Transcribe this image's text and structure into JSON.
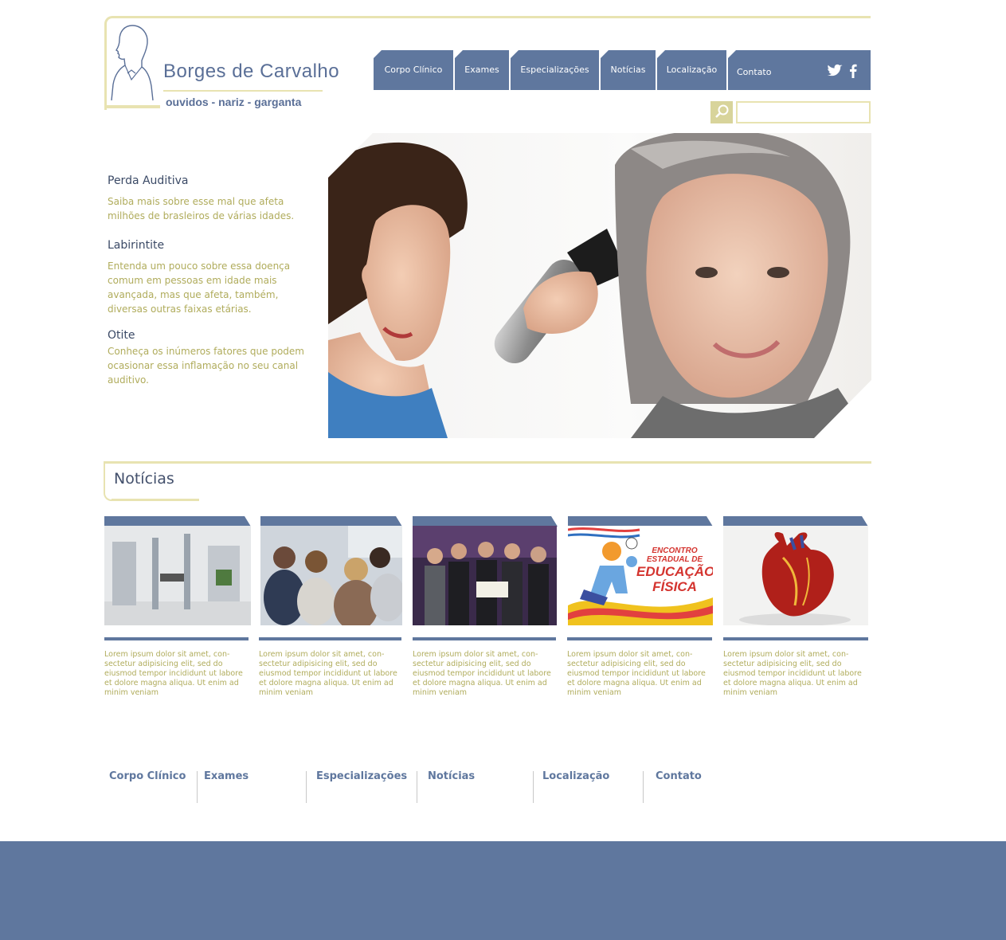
{
  "brand": {
    "name": "Borges de Carvalho",
    "tagline": "ouvidos - nariz - garganta"
  },
  "nav": {
    "items": [
      "Corpo Clínico",
      "Exames",
      "Especializações",
      "Notícias",
      "Localização",
      "Contato"
    ],
    "social": [
      "twitter-icon",
      "facebook-icon"
    ]
  },
  "search": {
    "placeholder": "",
    "value": ""
  },
  "features": [
    {
      "title": "Perda Auditiva",
      "text": "Saiba mais sobre esse mal que afeta milhões de brasleiros de várias idades."
    },
    {
      "title": "Labirintite",
      "text": "Entenda um pouco sobre essa doença comum em pessoas em idade mais avançada, mas que afeta, também, diversas outras faixas etárias."
    },
    {
      "title": "Otite",
      "text": "Conheça os inúmeros fatores que podem ocasionar essa inflamação no seu canal auditivo."
    }
  ],
  "news": {
    "heading": "Notícias",
    "cards": [
      {
        "image": "gym-photo",
        "text": "Lorem ipsum dolor sit amet, con-sectetur adipisicing elit, sed do eiusmod tempor incididunt ut labore et dolore magna aliqua. Ut enim ad minim veniam"
      },
      {
        "image": "audience-photo",
        "text": "Lorem ipsum dolor sit amet, con-sectetur adipisicing elit, sed do eiusmod tempor incididunt ut labore et dolore magna aliqua. Ut enim ad minim veniam"
      },
      {
        "image": "award-photo",
        "text": "Lorem ipsum dolor sit amet, con-sectetur adipisicing elit, sed do eiusmod tempor incididunt ut labore et dolore magna aliqua. Ut enim ad minim veniam"
      },
      {
        "image": "event-poster",
        "poster_lines": [
          "ENCONTRO",
          "ESTADUAL DE",
          "EDUCAÇÃO",
          "FÍSICA"
        ],
        "text": "Lorem ipsum dolor sit amet, con-sectetur adipisicing elit, sed do eiusmod tempor incididunt ut labore et dolore magna aliqua. Ut enim ad minim veniam"
      },
      {
        "image": "heart-model",
        "text": "Lorem ipsum dolor sit amet, con-sectetur adipisicing elit, sed do eiusmod tempor incididunt ut labore et dolore magna aliqua. Ut enim ad minim veniam"
      }
    ]
  },
  "footer": {
    "links": [
      "Corpo Clínico",
      "Exames",
      "Especializações",
      "Notícias",
      "Localização",
      "Contato"
    ]
  },
  "colors": {
    "primary": "#5f779e",
    "accent_text": "#b0ac5c",
    "border": "#e8e3b1",
    "heading": "#3b4a66"
  }
}
